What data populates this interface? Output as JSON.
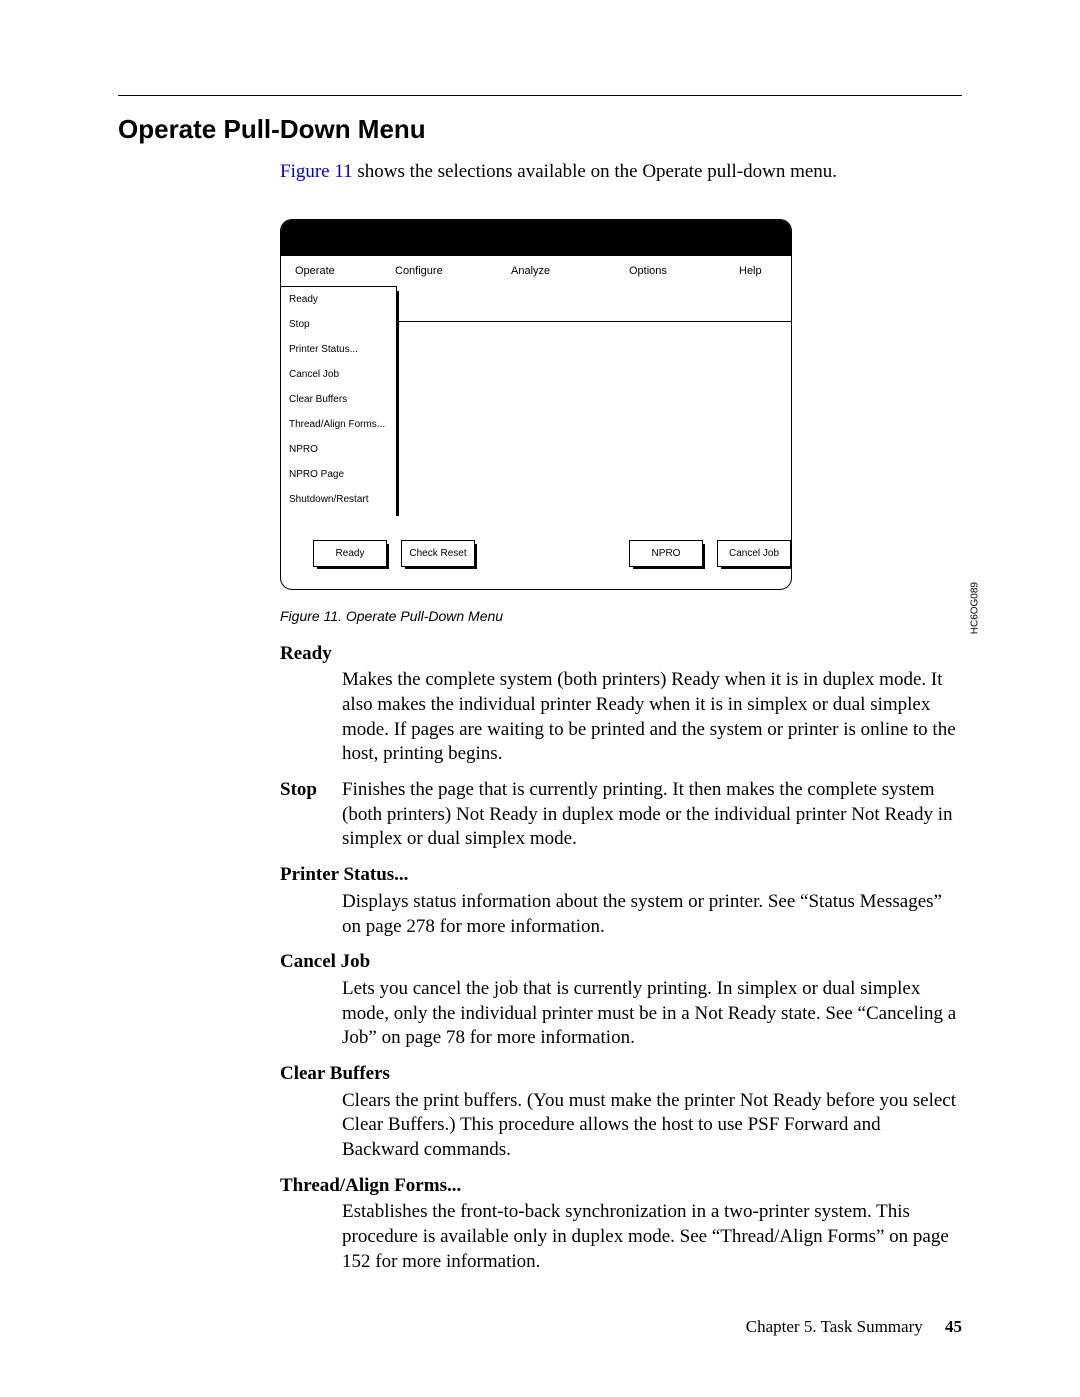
{
  "section_title": "Operate Pull-Down Menu",
  "intro_link": "Figure 11",
  "intro_rest": " shows the selections available on the Operate pull-down menu.",
  "menubar": {
    "operate": "Operate",
    "configure": "Configure",
    "analyze": "Analyze",
    "options": "Options",
    "help": "Help"
  },
  "dropdown_items": [
    "Ready",
    "Stop",
    "Printer Status...",
    "Cancel Job",
    "Clear Buffers",
    "Thread/Align Forms...",
    "NPRO",
    "NPRO Page",
    "Shutdown/Restart"
  ],
  "buttons": {
    "ready": "Ready",
    "check_reset": "Check Reset",
    "npro": "NPRO",
    "cancel_job": "Cancel Job"
  },
  "side_code": "HC6OG089",
  "caption": "Figure 11. Operate Pull-Down Menu",
  "definitions": {
    "ready_term": "Ready",
    "ready_body": "Makes the complete system (both printers) Ready when it is in duplex mode. It also makes the individual printer Ready when it is in simplex or dual simplex mode. If pages are waiting to be printed and the system or printer is online to the host, printing begins.",
    "stop_term": "Stop",
    "stop_body": "Finishes the page that is currently printing. It then makes the complete system (both printers) Not Ready in duplex mode or the individual printer Not Ready in simplex or dual simplex mode.",
    "printer_status_term": "Printer Status...",
    "printer_status_body": "Displays status information about the system or printer. See “Status Messages” on page 278 for more information.",
    "cancel_job_term": "Cancel Job",
    "cancel_job_body": "Lets you cancel the job that is currently printing. In simplex or dual simplex mode, only the individual printer must be in a Not Ready state. See “Canceling a Job” on page 78 for more information.",
    "clear_buffers_term": "Clear Buffers",
    "clear_buffers_body": "Clears the print buffers. (You must make the printer Not Ready before you select Clear Buffers.) This procedure allows the host to use PSF Forward and Backward commands.",
    "thread_align_term": "Thread/Align Forms...",
    "thread_align_body": "Establishes the front-to-back synchronization in a two-printer system. This procedure is available only in duplex mode. See “Thread/Align Forms” on page 152 for more information."
  },
  "footer_chapter": "Chapter 5. Task Summary",
  "footer_page": "45"
}
